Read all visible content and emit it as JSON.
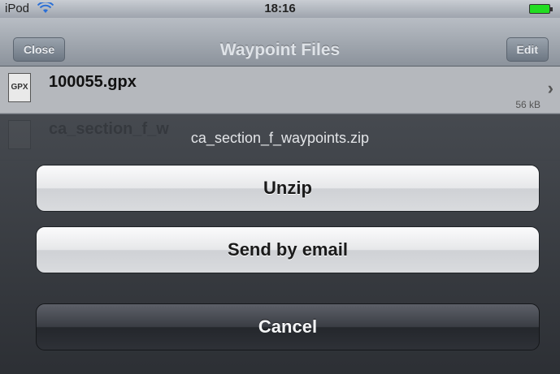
{
  "status_bar": {
    "carrier": "iPod",
    "time": "18:16",
    "wifi_icon": "wifi-icon",
    "battery_icon": "battery-icon"
  },
  "nav_bar": {
    "title": "Waypoint Files",
    "left_button": "Close",
    "right_button": "Edit"
  },
  "file_list": {
    "items": [
      {
        "icon_label": "GPX",
        "name": "100055.gpx",
        "size": "56 kB"
      },
      {
        "icon_label": "",
        "name": "ca_section_f_w",
        "size": ""
      }
    ]
  },
  "action_sheet": {
    "title": "ca_section_f_waypoints.zip",
    "buttons": [
      {
        "label": "Unzip"
      },
      {
        "label": "Send by email"
      }
    ],
    "cancel_label": "Cancel"
  }
}
